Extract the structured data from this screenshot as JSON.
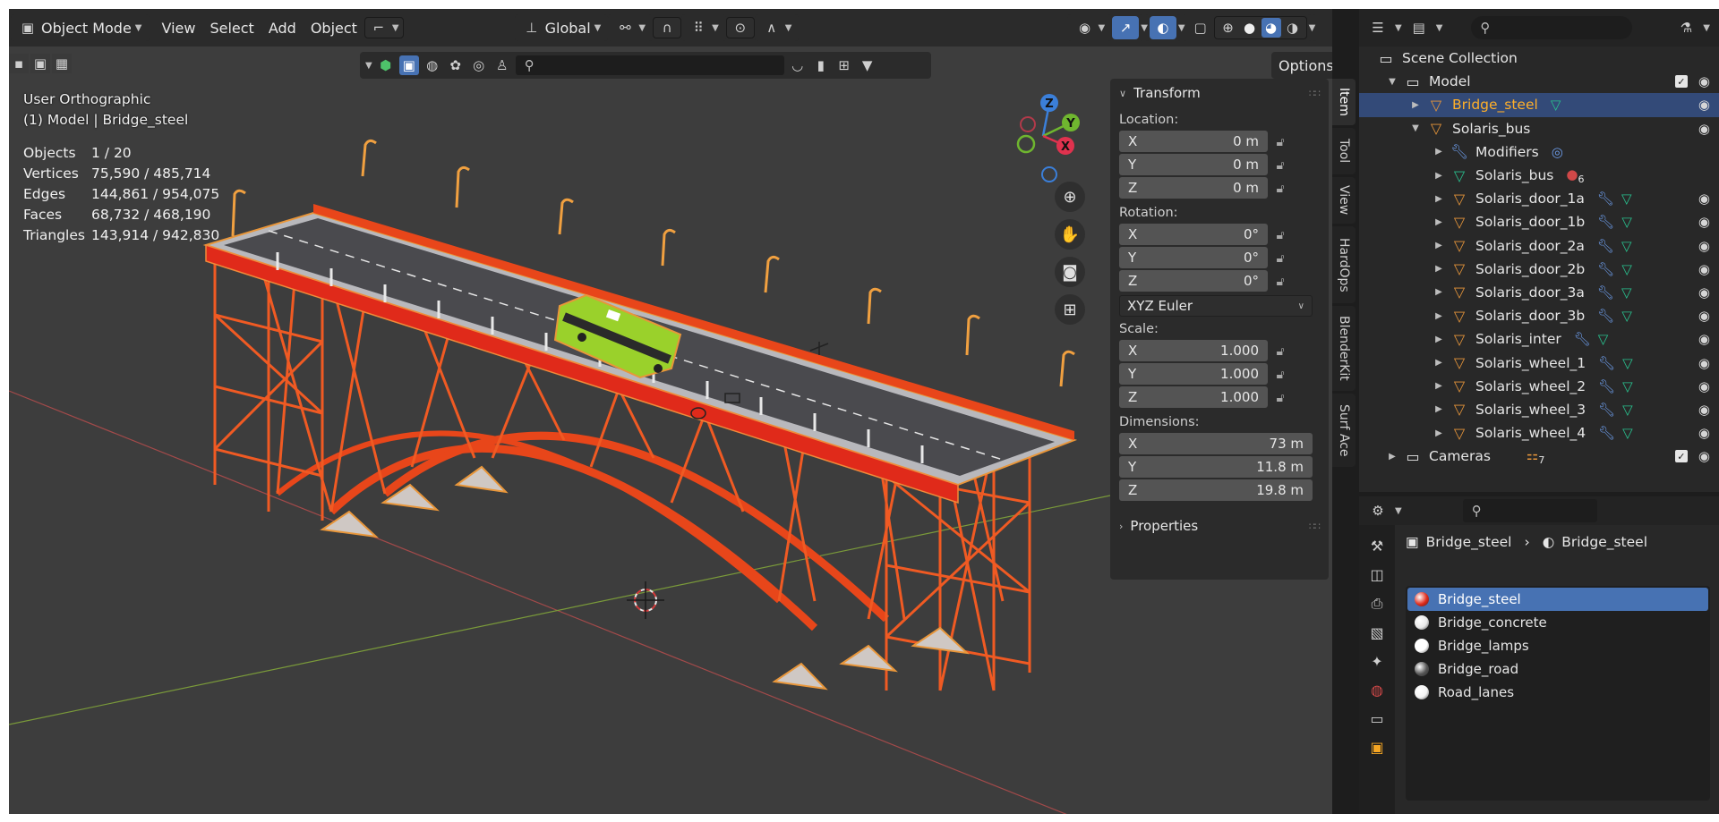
{
  "header": {
    "mode": "Object Mode",
    "menus": [
      "View",
      "Select",
      "Add",
      "Object"
    ],
    "orientation": "Global",
    "options": "Options"
  },
  "overlay": {
    "view_name": "User Orthographic",
    "active": "(1) Model | Bridge_steel"
  },
  "stats": [
    {
      "label": "Objects",
      "value": "1 / 20"
    },
    {
      "label": "Vertices",
      "value": "75,590 / 485,714"
    },
    {
      "label": "Edges",
      "value": "144,861 / 954,075"
    },
    {
      "label": "Faces",
      "value": "68,732 / 468,190"
    },
    {
      "label": "Triangles",
      "value": "143,914 / 942,830"
    }
  ],
  "gizmo": {
    "z": "Z",
    "y": "Y",
    "x": "X"
  },
  "transform": {
    "title": "Transform",
    "location_label": "Location:",
    "location": [
      {
        "axis": "X",
        "value": "0 m"
      },
      {
        "axis": "Y",
        "value": "0 m"
      },
      {
        "axis": "Z",
        "value": "0 m"
      }
    ],
    "rotation_label": "Rotation:",
    "rotation": [
      {
        "axis": "X",
        "value": "0°"
      },
      {
        "axis": "Y",
        "value": "0°"
      },
      {
        "axis": "Z",
        "value": "0°"
      }
    ],
    "rotation_mode": "XYZ Euler",
    "scale_label": "Scale:",
    "scale": [
      {
        "axis": "X",
        "value": "1.000"
      },
      {
        "axis": "Y",
        "value": "1.000"
      },
      {
        "axis": "Z",
        "value": "1.000"
      }
    ],
    "dimensions_label": "Dimensions:",
    "dimensions": [
      {
        "axis": "X",
        "value": "73 m"
      },
      {
        "axis": "Y",
        "value": "11.8 m"
      },
      {
        "axis": "Z",
        "value": "19.8 m"
      }
    ],
    "properties": "Properties"
  },
  "sidebar_tabs": [
    "Item",
    "Tool",
    "View",
    "HardOps",
    "BlenderKit",
    "Surf Ace"
  ],
  "outliner": {
    "scene_collection": "Scene Collection",
    "model": "Model",
    "bridge_steel": "Bridge_steel",
    "solaris_bus": "Solaris_bus",
    "modifiers": "Modifiers",
    "solaris_bus_mesh": "Solaris_bus",
    "mesh_users": "6",
    "children": [
      "Solaris_door_1a",
      "Solaris_door_1b",
      "Solaris_door_2a",
      "Solaris_door_2b",
      "Solaris_door_3a",
      "Solaris_door_3b",
      "Solaris_inter",
      "Solaris_wheel_1",
      "Solaris_wheel_2",
      "Solaris_wheel_3",
      "Solaris_wheel_4"
    ],
    "cameras": "Cameras",
    "camera_count": "7"
  },
  "properties": {
    "breadcrumb_object": "Bridge_steel",
    "breadcrumb_material": "Bridge_steel",
    "materials": [
      {
        "name": "Bridge_steel",
        "color": "#e02a1a"
      },
      {
        "name": "Bridge_concrete",
        "color": "#e8e8e8"
      },
      {
        "name": "Bridge_lamps",
        "color": "#ffffff"
      },
      {
        "name": "Bridge_road",
        "color": "#555555"
      },
      {
        "name": "Road_lanes",
        "color": "#f2f2f2"
      }
    ]
  },
  "colors": {
    "accent": "#4772b3",
    "selected_orange": "#ffaf29",
    "steel": "#e84a1c"
  }
}
